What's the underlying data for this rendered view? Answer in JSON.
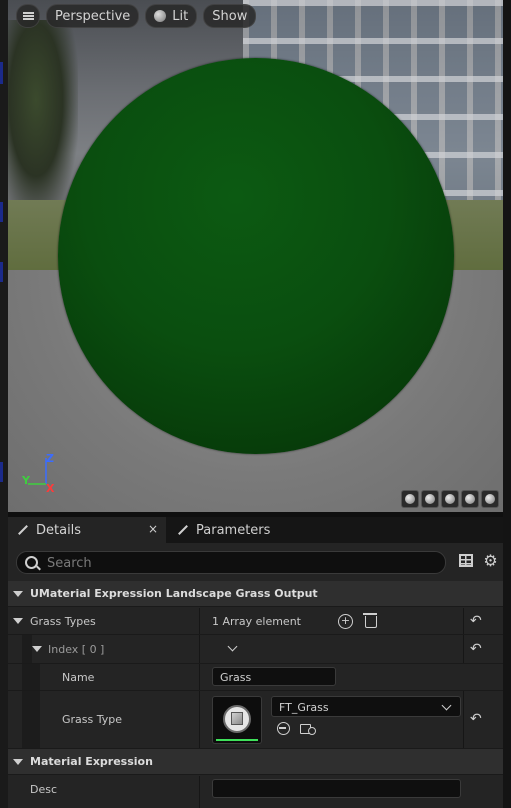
{
  "viewport": {
    "menu_icon": "hamburger-menu-icon",
    "perspective_label": "Perspective",
    "lit_label": "Lit",
    "show_label": "Show",
    "axis": {
      "z": "Z",
      "y": "Y",
      "x": "X"
    },
    "preview_sphere_color": "#0a4e0f"
  },
  "tabs": [
    {
      "label": "Details",
      "icon": "pencil-icon",
      "active": true,
      "close": "×"
    },
    {
      "label": "Parameters",
      "icon": "pencil-icon",
      "active": false
    }
  ],
  "details": {
    "search_placeholder": "Search",
    "sections": {
      "output": {
        "title": "UMaterial Expression Landscape Grass Output",
        "grass_types_label": "Grass Types",
        "grass_types_value": "1 Array element",
        "index_label": "Index [ 0 ]",
        "name_label": "Name",
        "name_value": "Grass",
        "grass_type_label": "Grass Type",
        "grass_type_value": "FT_Grass"
      },
      "material_expression": {
        "title": "Material Expression",
        "desc_label": "Desc",
        "desc_value": ""
      }
    }
  },
  "colors": {
    "panel_bg": "#242424",
    "category_bg": "#2f2f2f",
    "accent_green": "#3fe05a"
  }
}
